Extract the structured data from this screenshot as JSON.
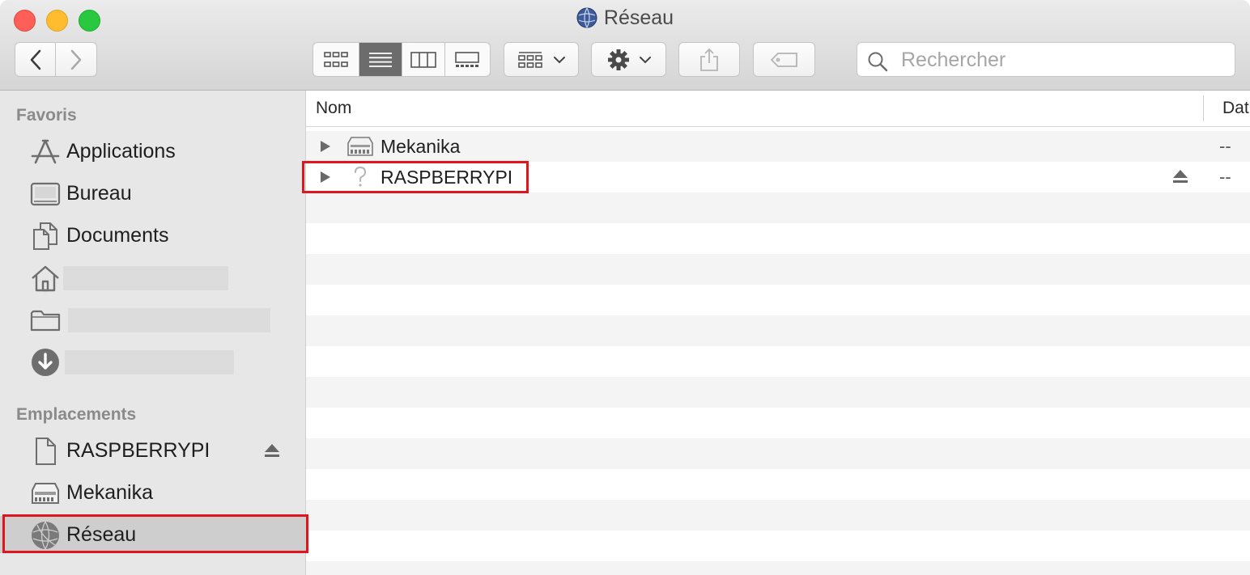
{
  "window": {
    "title": "Réseau"
  },
  "toolbar": {
    "back_icon": "chevron-left-icon",
    "forward_icon": "chevron-right-icon",
    "view_modes": [
      "icon-view-icon",
      "list-view-icon",
      "column-view-icon",
      "gallery-view-icon"
    ],
    "active_view": "list-view-icon",
    "group_icon": "group-by-icon",
    "action_icon": "gear-icon",
    "share_icon": "share-icon",
    "tag_icon": "tag-icon"
  },
  "search": {
    "placeholder": "Rechercher"
  },
  "sidebar": {
    "favorites_title": "Favoris",
    "favorites": [
      {
        "label": "Applications",
        "icon": "applications-icon"
      },
      {
        "label": "Bureau",
        "icon": "desktop-icon"
      },
      {
        "label": "Documents",
        "icon": "documents-icon"
      },
      {
        "label": "",
        "icon": "home-icon"
      },
      {
        "label": "",
        "icon": "folder-icon"
      },
      {
        "label": "",
        "icon": "downloads-icon"
      }
    ],
    "locations_title": "Emplacements",
    "locations": [
      {
        "label": "RASPBERRYPI",
        "icon": "document-icon",
        "ejectable": true
      },
      {
        "label": "Mekanika",
        "icon": "server-icon",
        "ejectable": false
      },
      {
        "label": "Réseau",
        "icon": "network-globe-icon",
        "selected": true
      }
    ]
  },
  "content": {
    "columns": {
      "name": "Nom",
      "date": "Dat"
    },
    "rows": [
      {
        "name": "Mekanika",
        "icon": "server-icon",
        "date": "--",
        "ejectable": false
      },
      {
        "name": "RASPBERRYPI",
        "icon": "unknown-question-icon",
        "date": "--",
        "ejectable": true
      }
    ]
  },
  "colors": {
    "highlight": "#e0161f",
    "selected_row": "#cfcece"
  }
}
